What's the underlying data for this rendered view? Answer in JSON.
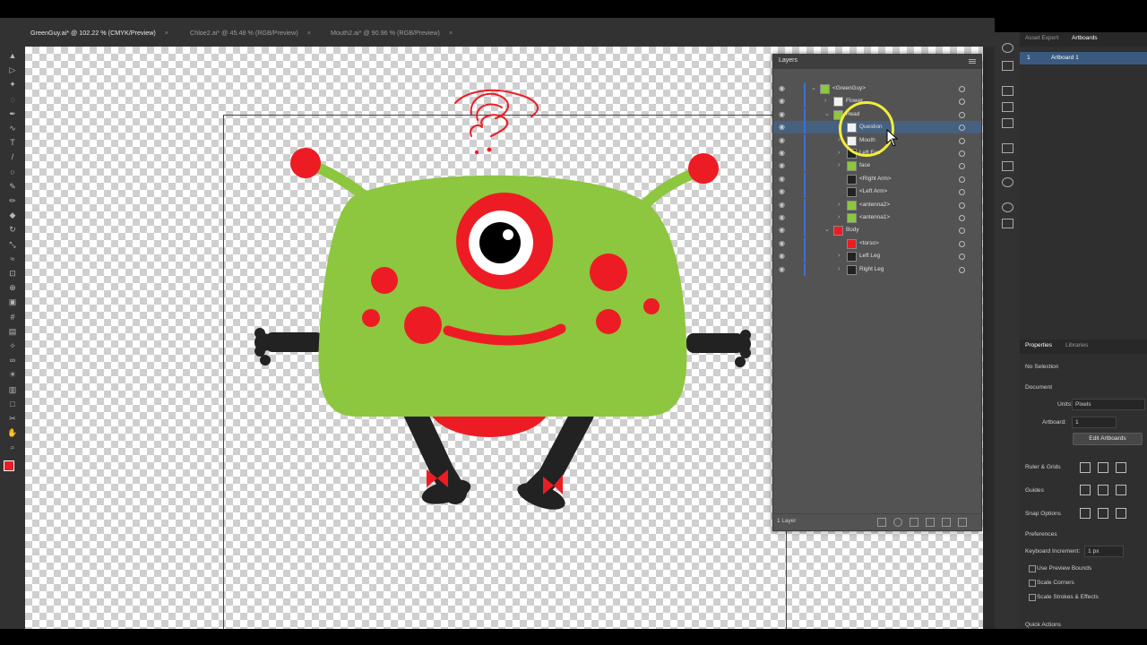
{
  "tabs": [
    {
      "label": "GreenGuy.ai* @ 102.22 % (CMYK/Preview)",
      "active": true
    },
    {
      "label": "Chloe2.ai* @ 45.48 % (RGB/Preview)",
      "active": false
    },
    {
      "label": "Mouth2.ai* @ 90.96 % (RGB/Preview)",
      "active": false
    }
  ],
  "tab_close": "×",
  "tools": [
    "select-tool",
    "direct-select-tool",
    "magic-wand-tool",
    "lasso-tool",
    "pen-tool",
    "curvature-tool",
    "type-tool",
    "line-tool",
    "ellipse-tool",
    "paintbrush-tool",
    "pencil-tool",
    "eraser-tool",
    "rotate-tool",
    "scale-tool",
    "width-tool",
    "free-transform-tool",
    "shape-builder-tool",
    "perspective-tool",
    "mesh-tool",
    "gradient-tool",
    "eyedropper-tool",
    "blend-tool",
    "symbol-sprayer-tool",
    "graph-tool",
    "artboard-tool",
    "slice-tool",
    "hand-tool",
    "zoom-tool"
  ],
  "layers": {
    "title": "Layers",
    "rows": [
      {
        "name": "<GreenGuy>",
        "indent": 0,
        "expanded": true,
        "selected": false,
        "thumb": "#8dc63f"
      },
      {
        "name": "Flower",
        "indent": 1,
        "expanded": false,
        "selected": false,
        "thumb": "#f2f2f2"
      },
      {
        "name": "Head",
        "indent": 1,
        "expanded": true,
        "selected": false,
        "thumb": "#8dc63f"
      },
      {
        "name": "Question",
        "indent": 2,
        "expanded": false,
        "selected": true,
        "thumb": "#f2f2f2"
      },
      {
        "name": "Mouth",
        "indent": 2,
        "expanded": false,
        "selected": false,
        "thumb": "#f2f2f2"
      },
      {
        "name": "Left Eye",
        "indent": 2,
        "expanded": false,
        "selected": false,
        "thumb": "#222222"
      },
      {
        "name": "face",
        "indent": 2,
        "expanded": false,
        "selected": false,
        "thumb": "#8dc63f"
      },
      {
        "name": "<Right Arm>",
        "indent": 2,
        "expanded": null,
        "selected": false,
        "thumb": "#222222"
      },
      {
        "name": "<Left Arm>",
        "indent": 2,
        "expanded": null,
        "selected": false,
        "thumb": "#222222"
      },
      {
        "name": "<antenna2>",
        "indent": 2,
        "expanded": false,
        "selected": false,
        "thumb": "#8dc63f"
      },
      {
        "name": "<antenna1>",
        "indent": 2,
        "expanded": false,
        "selected": false,
        "thumb": "#8dc63f"
      },
      {
        "name": "Body",
        "indent": 1,
        "expanded": true,
        "selected": false,
        "thumb": "#ed1c24"
      },
      {
        "name": "<torso>",
        "indent": 2,
        "expanded": null,
        "selected": false,
        "thumb": "#ed1c24"
      },
      {
        "name": "Left Leg",
        "indent": 2,
        "expanded": false,
        "selected": false,
        "thumb": "#222222"
      },
      {
        "name": "Right Leg",
        "indent": 2,
        "expanded": false,
        "selected": false,
        "thumb": "#222222"
      }
    ],
    "footer": "1 Layer"
  },
  "artboards_panel": {
    "tab1": "Asset Export",
    "tab2": "Artboards",
    "row_index": "1",
    "row_name": "Artboard 1"
  },
  "properties": {
    "tab1": "Properties",
    "tab2": "Libraries",
    "no_selection": "No Selection",
    "document": "Document",
    "units_label": "Units:",
    "units_value": "Pixels",
    "artboard_label": "Artboard:",
    "artboard_value": "1",
    "edit_artboards": "Edit Artboards",
    "ruler_grids": "Ruler & Grids",
    "guides": "Guides",
    "snap_options": "Snap Options",
    "preferences": "Preferences",
    "keyboard_increment_label": "Keyboard Increment:",
    "keyboard_increment_value": "1 px",
    "use_preview_bounds": "Use Preview Bounds",
    "scale_corners": "Scale Corners",
    "scale_strokes": "Scale Strokes & Effects",
    "quick_actions": "Quick Actions"
  },
  "colors": {
    "green": "#8dc63f",
    "red": "#ed1c24",
    "dark": "#222222",
    "ui_bg": "#323232",
    "highlight": "#46607f"
  }
}
